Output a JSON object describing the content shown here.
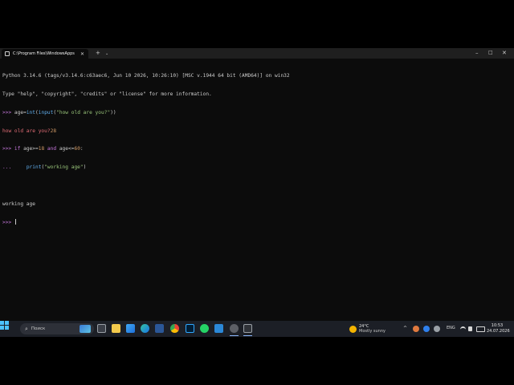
{
  "window": {
    "tab_title": "C:\\Program Files\\WindowsApps",
    "tab_close": "✕",
    "new_tab": "+",
    "tab_menu": "⌄",
    "minimize": "–",
    "maximize": "□",
    "close": "✕"
  },
  "terminal": {
    "line1": "Python 3.14.6 (tags/v3.14.6:c63aec6, Jun 10 2026, 10:26:10) [MSC v.1944 64 bit (AMD64)] on win32",
    "line2": "Type \"help\", \"copyright\", \"credits\" or \"license\" for more information.",
    "prompt": ">>>",
    "cont_prompt": "...",
    "l3_a": " age=",
    "l3_int": "int",
    "l3_b": "(",
    "l3_input": "input",
    "l3_c": "(",
    "l3_str": "\"how old are you?\"",
    "l3_d": "))",
    "l4_question": "how old are you?",
    "l4_answer": "28",
    "l5_if": "if",
    "l5_a": " age>=",
    "l5_n1": "18",
    "l5_and": "and",
    "l5_b": " age<=",
    "l5_n2": "60",
    "l5_c": ":",
    "l6_indent": "     ",
    "l6_print": "print",
    "l6_a": "(",
    "l6_str": "\"working age\"",
    "l6_b": ")",
    "output": "working age"
  },
  "taskbar": {
    "search_icon": "⌕",
    "search_placeholder": "Поиск",
    "weather_temp": "24°C",
    "weather_desc": "Mostly sunny",
    "tray_chevron": "^",
    "lang": "ENG",
    "time": "10:53",
    "date": "24.07.2026"
  },
  "colors": {
    "terminal_bg": "#0c0c0c",
    "taskbar_bg": "#1c1f26",
    "prompt": "#c678dd",
    "string": "#98c379",
    "number": "#d19a66",
    "function": "#61afef"
  }
}
